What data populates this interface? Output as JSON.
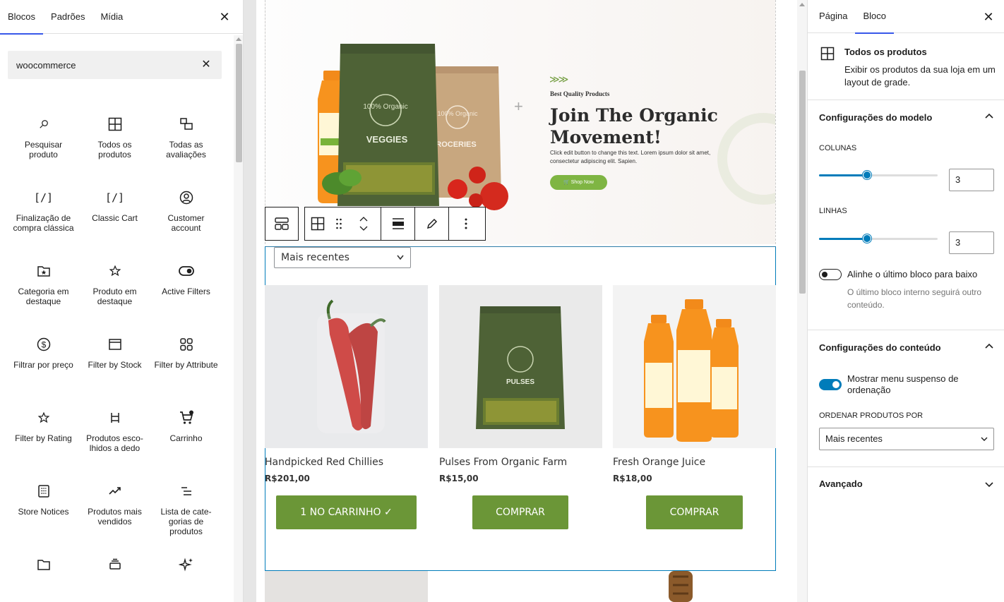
{
  "inserter": {
    "tabs": [
      "Blocos",
      "Padrões",
      "Mídia"
    ],
    "search_value": "woocommerce",
    "blocks": [
      {
        "label": "Pesquisar produto",
        "icon": "search-icon"
      },
      {
        "label": "Todos os produtos",
        "icon": "grid-icon"
      },
      {
        "label": "Todas as avaliações",
        "icon": "reviews-icon"
      },
      {
        "label": "Finalização de compra clássica",
        "icon": "shortcode-icon"
      },
      {
        "label": "Classic Cart",
        "icon": "shortcode-icon"
      },
      {
        "label": "Customer account",
        "icon": "user-circle-icon"
      },
      {
        "label": "Categoria em destaque",
        "icon": "folder-star-icon"
      },
      {
        "label": "Produto em destaque",
        "icon": "star-icon"
      },
      {
        "label": "Active Filters",
        "icon": "toggle-icon"
      },
      {
        "label": "Filtrar por preço",
        "icon": "dollar-circle-icon"
      },
      {
        "label": "Filter by Stock",
        "icon": "archive-icon"
      },
      {
        "label": "Filter by Attribute",
        "icon": "category-grid-icon"
      },
      {
        "label": "Filter by Rating",
        "icon": "star-icon"
      },
      {
        "label": "Produtos esco-lhidos a dedo",
        "icon": "hand-picked-icon"
      },
      {
        "label": "Carrinho",
        "icon": "cart-icon"
      },
      {
        "label": "Store Notices",
        "icon": "notice-icon"
      },
      {
        "label": "Produtos mais vendidos",
        "icon": "trending-icon"
      },
      {
        "label": "Lista de cate-gorias de produtos",
        "icon": "list-icon"
      },
      {
        "label": "",
        "icon": "folder-icon"
      },
      {
        "label": "",
        "icon": "stack-icon"
      },
      {
        "label": "",
        "icon": "sparkle-icon"
      }
    ]
  },
  "hero": {
    "tag": "Best Quality Products",
    "title": "Join The Organic Movement!",
    "text": "Click edit button to change this text. Lorem ipsum dolor sit amet, consectetur adipiscing elit. Sapien.",
    "button": "Shop Now",
    "bag_labels": [
      "100% Organic",
      "VEGGIES",
      "100% Organic",
      "ROCERIES"
    ]
  },
  "products": {
    "sort_value": "Mais recentes",
    "items": [
      {
        "name": "Handpicked Red Chillies",
        "price": "R$201,00",
        "button": "1 NO CARRINHO ✓"
      },
      {
        "name": "Pulses From Organic Farm",
        "price": "R$15,00",
        "button": "COMPRAR",
        "bag_label": "PULSES"
      },
      {
        "name": "Fresh Orange Juice",
        "price": "R$18,00",
        "button": "COMPRAR"
      }
    ]
  },
  "settings": {
    "tabs": [
      "Página",
      "Bloco"
    ],
    "block_title": "Todos os produtos",
    "block_desc": "Exibir os produtos da sua loja em um layout de grade.",
    "model_panel": "Configurações do modelo",
    "columns_label": "COLUNAS",
    "columns_value": "3",
    "rows_label": "LINHAS",
    "rows_value": "3",
    "align_label": "Alinhe o último bloco para baixo",
    "align_help": "O último bloco interno seguirá outro conteúdo.",
    "content_panel": "Configurações do conteúdo",
    "dropdown_label": "Mostrar menu suspenso de ordenação",
    "order_label": "ORDENAR PRODUTOS POR",
    "order_value": "Mais recentes",
    "advanced": "Avançado"
  },
  "colors": {
    "accent": "#007cba",
    "wp_blue": "#3858e9",
    "button_green": "#6b9637",
    "hero_button": "#7fb543"
  }
}
